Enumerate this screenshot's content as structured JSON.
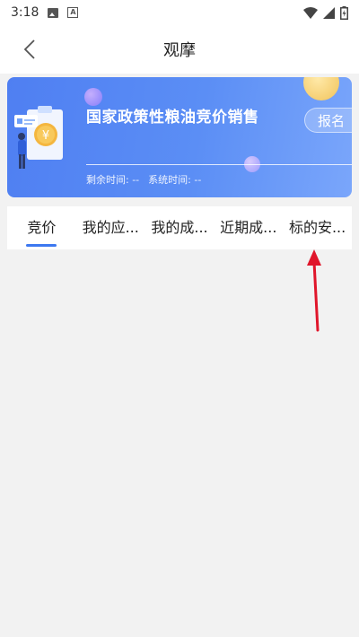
{
  "status_bar": {
    "time": "3:18",
    "a_icon_label": "A"
  },
  "header": {
    "title": "观摩",
    "back_icon": "chevron-left-icon"
  },
  "banner": {
    "title": "国家政策性粮油竞价销售",
    "signup_label": "报名",
    "remaining_label": "剩余时间: --",
    "system_label": "系统时间: --",
    "illustration": "yuan-coin-clipboard-illustration"
  },
  "tabs": [
    {
      "label": "竞价",
      "active": true
    },
    {
      "label": "我的应..."
    },
    {
      "label": "我的成..."
    },
    {
      "label": "近期成..."
    },
    {
      "label": "标的安..."
    }
  ],
  "colors": {
    "accent": "#3d78f0",
    "banner": "#5b8ef5",
    "annotation": "#e0162b"
  }
}
